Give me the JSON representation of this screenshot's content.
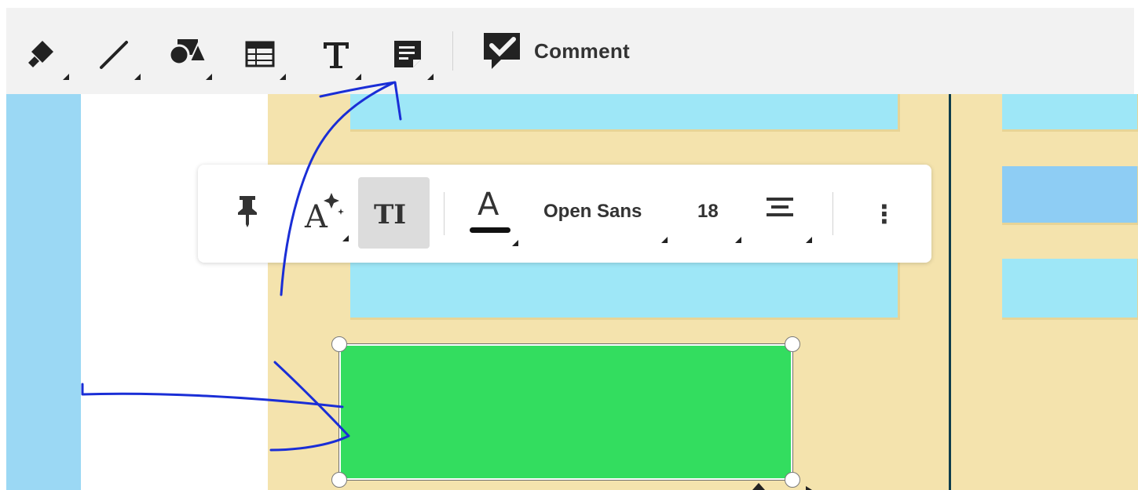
{
  "toolbar": {
    "tools": [
      {
        "name": "fill-tool",
        "icon": "paint-bucket-icon"
      },
      {
        "name": "line-tool",
        "icon": "line-icon"
      },
      {
        "name": "shapes-tool",
        "icon": "shapes-icon"
      },
      {
        "name": "table-tool",
        "icon": "table-icon"
      },
      {
        "name": "text-tool",
        "icon": "text-icon"
      },
      {
        "name": "note-tool",
        "icon": "note-icon"
      }
    ],
    "comment_label": "Comment"
  },
  "format_bar": {
    "text_tool_glyph": "TI",
    "text_color_glyph": "A",
    "font_family": "Open Sans",
    "font_size": "18",
    "more_glyph": "⋮"
  },
  "colors": {
    "toolbar_bg": "#f2f2f2",
    "selected_shape": "#33dd5f",
    "sticky_light_blue": "#9ee7f7",
    "sticky_blue": "#8ecdf4",
    "lane_tan": "#f4e3ad",
    "annotation_pen": "#1a2ed6"
  }
}
